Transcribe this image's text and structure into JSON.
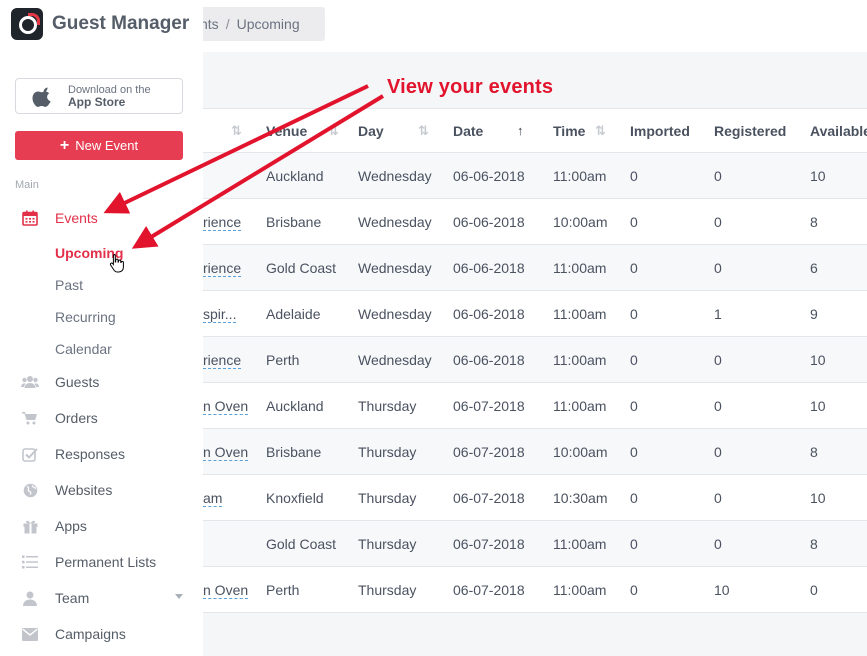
{
  "app": {
    "name": "Guest Manager"
  },
  "breadcrumb": {
    "parent": "nts",
    "separator": "/",
    "current": "Upcoming"
  },
  "appstore": {
    "line1": "Download on the",
    "line2": "App Store"
  },
  "new_event_label": "New Event",
  "sidebar": {
    "section": "Main",
    "events": "Events",
    "sub": [
      "Upcoming",
      "Past",
      "Recurring",
      "Calendar"
    ],
    "items": [
      "Guests",
      "Orders",
      "Responses",
      "Websites",
      "Apps",
      "Permanent Lists",
      "Team",
      "Campaigns"
    ]
  },
  "annotation": {
    "text": "View your events"
  },
  "colors": {
    "accent": "#e73d52",
    "annotation": "#e2142d",
    "link_underline": "#5aa0d8"
  },
  "table": {
    "headers": [
      "",
      "Venue",
      "Day",
      "Date",
      "Time",
      "Imported",
      "Registered",
      "Available"
    ],
    "rows": [
      [
        "",
        "Auckland",
        "Wednesday",
        "06-06-2018",
        "11:00am",
        "0",
        "0",
        "10"
      ],
      [
        "rience",
        "Brisbane",
        "Wednesday",
        "06-06-2018",
        "10:00am",
        "0",
        "0",
        "8"
      ],
      [
        "rience",
        "Gold Coast",
        "Wednesday",
        "06-06-2018",
        "11:00am",
        "0",
        "0",
        "6"
      ],
      [
        "spir...",
        "Adelaide",
        "Wednesday",
        "06-06-2018",
        "11:00am",
        "0",
        "1",
        "9"
      ],
      [
        "rience",
        "Perth",
        "Wednesday",
        "06-06-2018",
        "11:00am",
        "0",
        "0",
        "10"
      ],
      [
        "n Oven",
        "Auckland",
        "Thursday",
        "06-07-2018",
        "11:00am",
        "0",
        "0",
        "10"
      ],
      [
        "n Oven",
        "Brisbane",
        "Thursday",
        "06-07-2018",
        "10:00am",
        "0",
        "0",
        "8"
      ],
      [
        "am",
        "Knoxfield",
        "Thursday",
        "06-07-2018",
        "10:30am",
        "0",
        "0",
        "10"
      ],
      [
        "",
        "Gold Coast",
        "Thursday",
        "06-07-2018",
        "11:00am",
        "0",
        "0",
        "8"
      ],
      [
        "n Oven",
        "Perth",
        "Thursday",
        "06-07-2018",
        "11:00am",
        "0",
        "10",
        "0"
      ]
    ]
  }
}
